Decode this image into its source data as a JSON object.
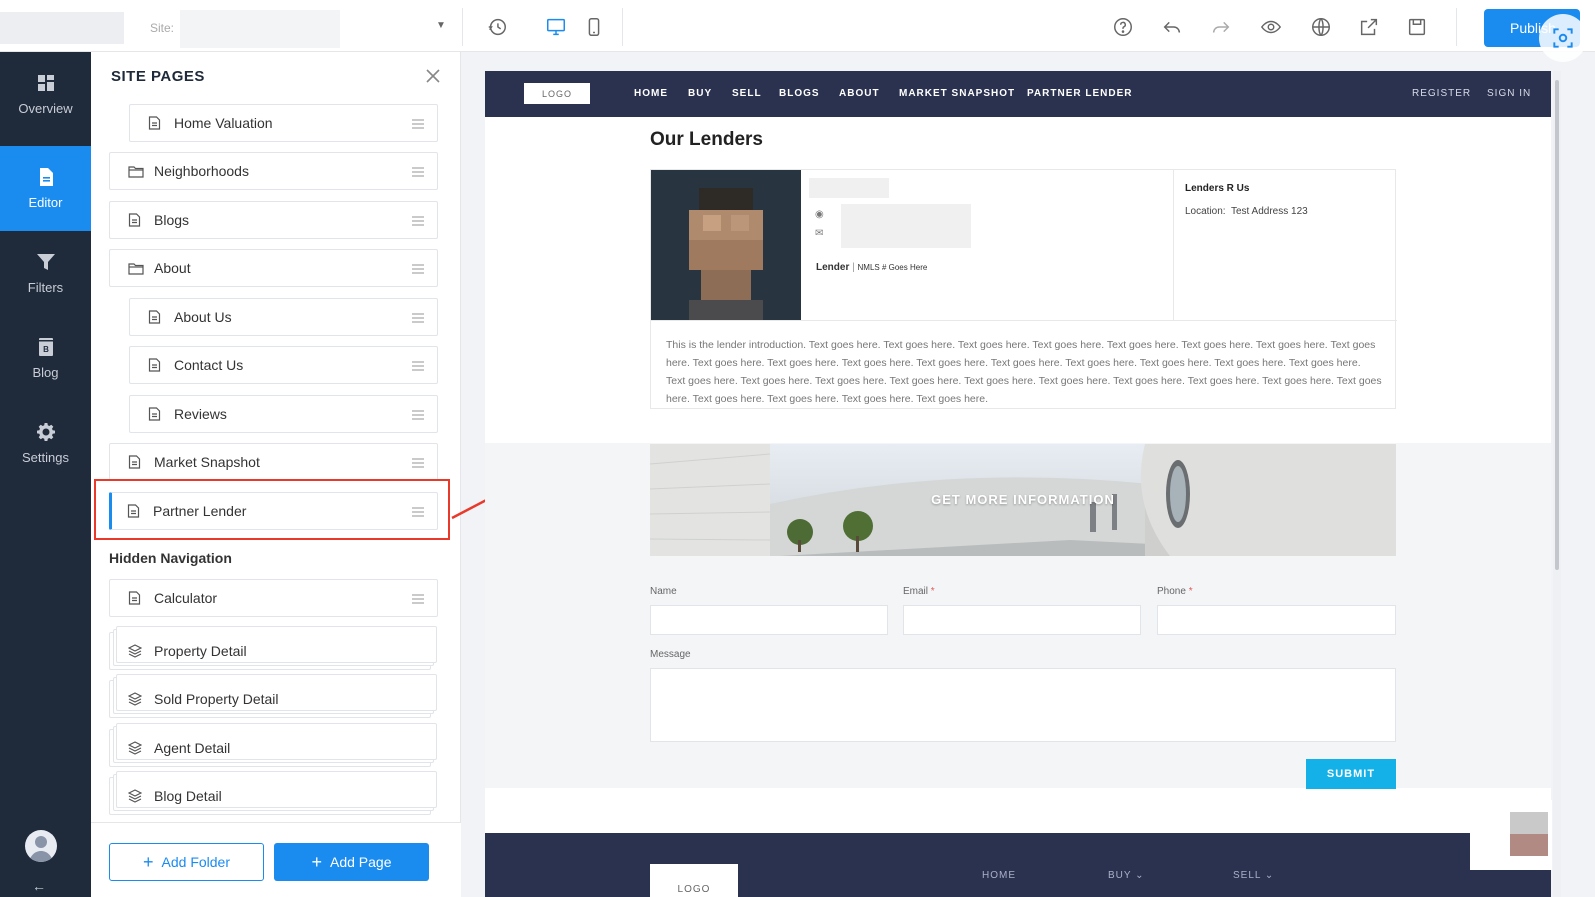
{
  "topbar": {
    "site_label": "Site:",
    "publish_label": "Publish"
  },
  "leftnav": {
    "items": [
      {
        "label": "Overview",
        "icon": "grid-icon"
      },
      {
        "label": "Editor",
        "icon": "document-icon"
      },
      {
        "label": "Filters",
        "icon": "funnel-icon"
      },
      {
        "label": "Blog",
        "icon": "blog-icon"
      },
      {
        "label": "Settings",
        "icon": "gear-icon"
      }
    ],
    "active": "Editor"
  },
  "panel": {
    "title": "SITE PAGES",
    "pages": [
      {
        "label": "Home Valuation",
        "type": "page"
      },
      {
        "label": "Neighborhoods",
        "type": "folder"
      },
      {
        "label": "Blogs",
        "type": "page"
      },
      {
        "label": "About",
        "type": "folder"
      },
      {
        "label": "About Us",
        "type": "page"
      },
      {
        "label": "Contact Us",
        "type": "page"
      },
      {
        "label": "Reviews",
        "type": "page"
      },
      {
        "label": "Market Snapshot",
        "type": "page"
      },
      {
        "label": "Partner Lender",
        "type": "page",
        "selected": true
      }
    ],
    "hidden_label": "Hidden Navigation",
    "hidden_pages": [
      {
        "label": "Calculator",
        "type": "page"
      },
      {
        "label": "Property Detail",
        "type": "template"
      },
      {
        "label": "Sold Property Detail",
        "type": "template"
      },
      {
        "label": "Agent Detail",
        "type": "template"
      },
      {
        "label": "Blog Detail",
        "type": "template"
      }
    ],
    "add_folder": "Add Folder",
    "add_page": "Add Page"
  },
  "preview": {
    "logo": "LOGO",
    "nav": [
      "HOME",
      "BUY",
      "SELL",
      "BLOGS",
      "ABOUT",
      "MARKET SNAPSHOT",
      "PARTNER LENDER"
    ],
    "nav_right": [
      "REGISTER",
      "SIGN IN"
    ],
    "heading": "Our Lenders",
    "lender": {
      "role": "Lender",
      "nmls": "NMLS # Goes Here",
      "company": "Lenders R Us",
      "location_label": "Location:",
      "location_value": "Test Address 123",
      "intro": "This is the lender introduction. Text goes here. Text goes here. Text goes here. Text goes here. Text goes here. Text goes here. Text goes here. Text goes here. Text goes here. Text goes here. Text goes here. Text goes here. Text goes here. Text goes here. Text goes here. Text goes here. Text goes here. Text goes here. Text goes here. Text goes here. Text goes here. Text goes here. Text goes here. Text goes here. Text goes here. Text goes here. Text goes here. Text goes here. Text goes here. Text goes here. Text goes here."
    },
    "banner_text": "GET MORE INFORMATION",
    "form": {
      "name_label": "Name",
      "email_label": "Email",
      "phone_label": "Phone",
      "message_label": "Message",
      "required_mark": "*",
      "submit": "SUBMIT"
    },
    "footer": {
      "logo": "LOGO",
      "links": [
        "HOME",
        "BUY ⌄",
        "SELL ⌄"
      ]
    }
  },
  "colors": {
    "accent": "#1a8bef",
    "nav_dark": "#1f2a3b",
    "site_nav": "#2b3250",
    "submit": "#13b1e8",
    "highlight": "#e8392a"
  }
}
